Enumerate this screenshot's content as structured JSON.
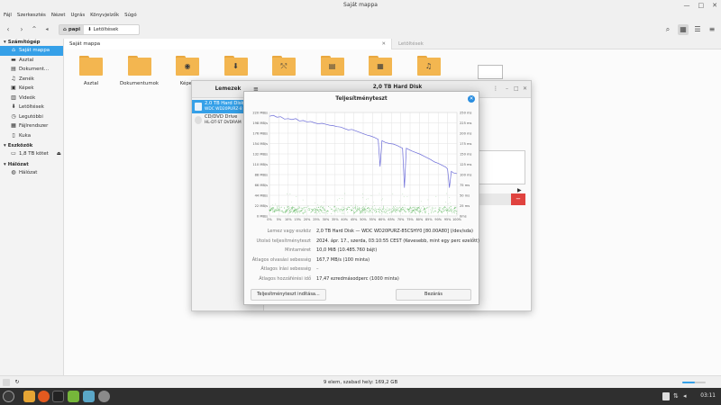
{
  "window": {
    "title": "Saját mappa"
  },
  "menu": [
    "Fájl",
    "Szerkesztés",
    "Nézet",
    "Ugrás",
    "Könyvjelzők",
    "Súgó"
  ],
  "path": {
    "home": "papi",
    "downloads": "Letöltések"
  },
  "sidebar": {
    "computer_header": "Számítógép",
    "computer_items": [
      {
        "label": "Saját mappa",
        "icon": "home-icon"
      },
      {
        "label": "Asztal",
        "icon": "desktop-icon"
      },
      {
        "label": "Dokument...",
        "icon": "document-icon"
      },
      {
        "label": "Zenék",
        "icon": "music-icon"
      },
      {
        "label": "Képek",
        "icon": "image-icon"
      },
      {
        "label": "Videók",
        "icon": "video-icon"
      },
      {
        "label": "Letöltések",
        "icon": "download-icon"
      },
      {
        "label": "Legutóbbi",
        "icon": "recent-icon"
      },
      {
        "label": "Fájlrendszer",
        "icon": "filesystem-icon"
      },
      {
        "label": "Kuka",
        "icon": "trash-icon"
      }
    ],
    "devices_header": "Eszközök",
    "devices_items": [
      {
        "label": "1,8 TB kötet",
        "icon": "drive-icon"
      }
    ],
    "network_header": "Hálózat",
    "network_items": [
      {
        "label": "Hálózat",
        "icon": "network-icon"
      }
    ]
  },
  "tabs": [
    "Saját mappa",
    "Letöltések"
  ],
  "files": [
    {
      "label": "Asztal",
      "glyph": ""
    },
    {
      "label": "Dokumentumok",
      "glyph": ""
    },
    {
      "label": "Képek",
      "glyph": "◉"
    },
    {
      "label": "",
      "glyph": "⬇"
    },
    {
      "label": "",
      "glyph": "⤲"
    },
    {
      "label": "",
      "glyph": "▤"
    },
    {
      "label": "",
      "glyph": "▦"
    },
    {
      "label": "",
      "glyph": "♫"
    }
  ],
  "status": {
    "text": "9 elem, szabad hely: 169,2 GB"
  },
  "clock": "03:11",
  "disks": {
    "side_title": "Lemezek",
    "right_title": "2,0 TB Hard Disk",
    "drives": [
      {
        "name": "2,0 TB Hard Disk",
        "sub": "WDC WD20PURZ-8",
        "selected": true
      },
      {
        "name": "CD/DVD Drive",
        "sub": "HL-DT-ST DVDRAM",
        "selected": false
      }
    ]
  },
  "benchmark": {
    "title": "Teljesítményteszt",
    "rows": [
      {
        "label": "Lemez vagy eszköz",
        "value": "2,0 TB Hard Disk — WDC WD20PURZ-85CSHY0 [80.00A80] (/dev/sda)",
        "grey": false
      },
      {
        "label": "Utolsó teljesítményteszt",
        "value": "2024. ápr. 17., szerda, 03:10:55 CEST (Kevesebb, mint egy perc ezelőtt)",
        "grey": false
      },
      {
        "label": "Mintaméret",
        "value": "10,0 MiB (10.485.760 bájt)",
        "grey": false
      },
      {
        "label": "Átlagos olvasási sebesség",
        "value": "167,7 MB/s (100 minta)",
        "grey": false
      },
      {
        "label": "Átlagos írási sebesség",
        "value": "–",
        "grey": true
      },
      {
        "label": "Átlagos hozzáférési idő",
        "value": "17,47 ezredmásodperc (1000 minta)",
        "grey": false
      }
    ],
    "start_button": "Teljesítményteszt indítása...",
    "close_button": "Bezárás"
  },
  "chart_data": {
    "type": "line",
    "title": "",
    "x_ticks": [
      "0%",
      "5%",
      "10%",
      "15%",
      "20%",
      "25%",
      "30%",
      "35%",
      "40%",
      "45%",
      "50%",
      "55%",
      "60%",
      "65%",
      "70%",
      "75%",
      "80%",
      "85%",
      "90%",
      "95%",
      "100%"
    ],
    "y_left_ticks": [
      "0 MB/s",
      "22 MB/s",
      "44 MB/s",
      "66 MB/s",
      "88 MB/s",
      "110 MB/s",
      "132 MB/s",
      "154 MB/s",
      "176 MB/s",
      "198 MB/s",
      "220 MB/s"
    ],
    "y_right_ticks": [
      "0ms",
      "25 ms",
      "50 ms",
      "75 ms",
      "100 ms",
      "125 ms",
      "150 ms",
      "175 ms",
      "200 ms",
      "225 ms",
      "250 ms"
    ],
    "ylim_left": [
      0,
      220
    ],
    "ylim_right": [
      0,
      250
    ],
    "xlim": [
      0,
      100
    ],
    "read_series": {
      "x": [
        0,
        2,
        4,
        6,
        8,
        10,
        12,
        14,
        16,
        18,
        20,
        22,
        24,
        26,
        28,
        30,
        32,
        34,
        36,
        38,
        40,
        42,
        44,
        46,
        48,
        50,
        52,
        54,
        56,
        58,
        59,
        60,
        61,
        62,
        64,
        66,
        68,
        70,
        71,
        72,
        73,
        74,
        76,
        78,
        80,
        82,
        84,
        86,
        88,
        90,
        92,
        94,
        95,
        96,
        97,
        98,
        100
      ],
      "y": [
        212,
        214,
        210,
        211,
        206,
        207,
        205,
        207,
        202,
        203,
        200,
        201,
        198,
        196,
        197,
        195,
        193,
        192,
        190,
        189,
        186,
        183,
        184,
        181,
        178,
        175,
        172,
        170,
        167,
        163,
        105,
        160,
        158,
        156,
        154,
        153,
        150,
        146,
        144,
        60,
        144,
        142,
        138,
        135,
        132,
        128,
        124,
        120,
        115,
        112,
        108,
        104,
        100,
        60,
        95,
        92,
        90
      ]
    },
    "access_band_ms": [
      5,
      25
    ],
    "colors": {
      "read": "#6b6bd8",
      "access": "#3aa63a",
      "grid": "#e2e2e2"
    }
  }
}
